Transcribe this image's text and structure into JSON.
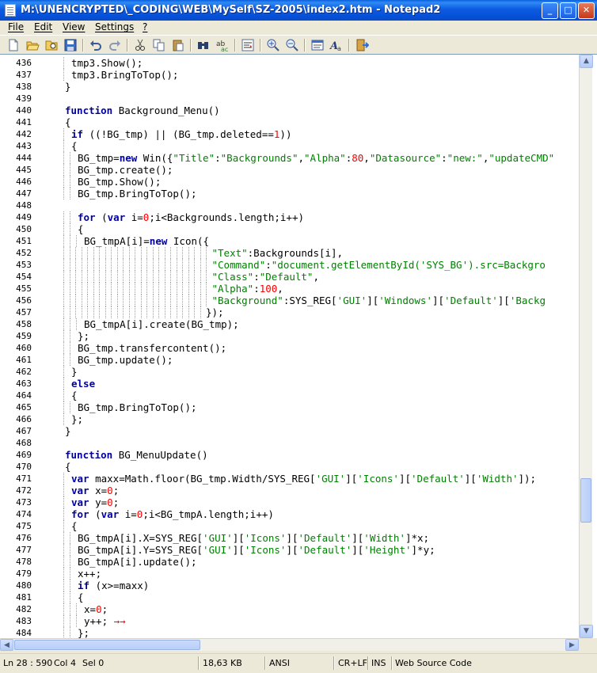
{
  "window": {
    "title": "M:\\UNENCRYPTED\\_CODING\\WEB\\MySelf\\SZ-2005\\index2.htm - Notepad2",
    "controls": {
      "minimize": "_",
      "maximize": "□",
      "close": "✕"
    }
  },
  "menu": [
    "File",
    "Edit",
    "View",
    "Settings",
    "?"
  ],
  "toolbar": {
    "icons": [
      "new-file-icon",
      "open-file-icon",
      "browse-icon",
      "save-icon",
      "undo-icon",
      "redo-icon",
      "cut-icon",
      "copy-icon",
      "paste-icon",
      "find-icon",
      "replace-icon",
      "word-wrap-icon",
      "zoom-in-icon",
      "zoom-out-icon",
      "scheme-icon",
      "font-icon",
      "exit-icon"
    ]
  },
  "colors": {
    "keyword": "#0000A0",
    "string": "#008000",
    "number": "#FF0000",
    "text": "#000000"
  },
  "editor": {
    "lines": [
      {
        "n": "436",
        "t": [
          [
            "p",
            "tmp3.Show();"
          ]
        ],
        "ind": 1
      },
      {
        "n": "437",
        "t": [
          [
            "p",
            "tmp3.BringToTop();"
          ]
        ],
        "ind": 1
      },
      {
        "n": "438",
        "t": [
          [
            "p",
            "}"
          ]
        ],
        "ind": 0
      },
      {
        "n": "439",
        "t": [],
        "ind": 0
      },
      {
        "n": "440",
        "t": [
          [
            "k",
            "function"
          ],
          [
            "p",
            " Background_Menu()"
          ]
        ],
        "ind": 0
      },
      {
        "n": "441",
        "t": [
          [
            "p",
            "{"
          ]
        ],
        "ind": 0
      },
      {
        "n": "442",
        "t": [
          [
            "k",
            "if"
          ],
          [
            "p",
            " ((!BG_tmp) || (BG_tmp.deleted=="
          ],
          [
            "n",
            "1"
          ],
          [
            "p",
            "))"
          ]
        ],
        "ind": 1
      },
      {
        "n": "443",
        "t": [
          [
            "p",
            "{"
          ]
        ],
        "ind": 1
      },
      {
        "n": "444",
        "t": [
          [
            "p",
            "BG_tmp="
          ],
          [
            "k",
            "new"
          ],
          [
            "p",
            " Win({"
          ],
          [
            "s",
            "\"Title\""
          ],
          [
            "p",
            ":"
          ],
          [
            "s",
            "\"Backgrounds\""
          ],
          [
            "p",
            ","
          ],
          [
            "s",
            "\"Alpha\""
          ],
          [
            "p",
            ":"
          ],
          [
            "n",
            "80"
          ],
          [
            "p",
            ","
          ],
          [
            "s",
            "\"Datasource\""
          ],
          [
            "p",
            ":"
          ],
          [
            "s",
            "\"new:\""
          ],
          [
            "p",
            ","
          ],
          [
            "s",
            "\"updateCMD\""
          ]
        ],
        "ind": 2
      },
      {
        "n": "445",
        "t": [
          [
            "p",
            "BG_tmp.create();"
          ]
        ],
        "ind": 2
      },
      {
        "n": "446",
        "t": [
          [
            "p",
            "BG_tmp.Show();"
          ]
        ],
        "ind": 2
      },
      {
        "n": "447",
        "t": [
          [
            "p",
            "BG_tmp.BringToTop();"
          ]
        ],
        "ind": 2
      },
      {
        "n": "448",
        "t": [],
        "ind": 0
      },
      {
        "n": "449",
        "t": [
          [
            "k",
            "for"
          ],
          [
            "p",
            " ("
          ],
          [
            "k",
            "var"
          ],
          [
            "p",
            " i="
          ],
          [
            "n",
            "0"
          ],
          [
            "p",
            ";i<Backgrounds.length;i++)"
          ]
        ],
        "ind": 2
      },
      {
        "n": "450",
        "t": [
          [
            "p",
            "{"
          ]
        ],
        "ind": 2
      },
      {
        "n": "451",
        "t": [
          [
            "p",
            "BG_tmpA[i]="
          ],
          [
            "k",
            "new"
          ],
          [
            "p",
            " Icon({"
          ]
        ],
        "ind": 3
      },
      {
        "n": "452",
        "t": [
          [
            "s",
            "\"Text\""
          ],
          [
            "p",
            ":Backgrounds[i],"
          ]
        ],
        "ind": 25
      },
      {
        "n": "453",
        "t": [
          [
            "s",
            "\"Command\""
          ],
          [
            "p",
            ":"
          ],
          [
            "s",
            "\"document.getElementById('SYS_BG').src=Backgro"
          ]
        ],
        "ind": 25
      },
      {
        "n": "454",
        "t": [
          [
            "s",
            "\"Class\""
          ],
          [
            "p",
            ":"
          ],
          [
            "s",
            "\"Default\""
          ],
          [
            "p",
            ","
          ]
        ],
        "ind": 25
      },
      {
        "n": "455",
        "t": [
          [
            "s",
            "\"Alpha\""
          ],
          [
            "p",
            ":"
          ],
          [
            "n",
            "100"
          ],
          [
            "p",
            ","
          ]
        ],
        "ind": 25
      },
      {
        "n": "456",
        "t": [
          [
            "s",
            "\"Background\""
          ],
          [
            "p",
            ":SYS_REG["
          ],
          [
            "s",
            "'GUI'"
          ],
          [
            "p",
            "]["
          ],
          [
            "s",
            "'Windows'"
          ],
          [
            "p",
            "]["
          ],
          [
            "s",
            "'Default'"
          ],
          [
            "p",
            "]["
          ],
          [
            "s",
            "'Backg"
          ]
        ],
        "ind": 25
      },
      {
        "n": "457",
        "t": [
          [
            "p",
            "});"
          ]
        ],
        "ind": 24
      },
      {
        "n": "458",
        "t": [
          [
            "p",
            "BG_tmpA[i].create(BG_tmp);"
          ]
        ],
        "ind": 3
      },
      {
        "n": "459",
        "t": [
          [
            "p",
            "};"
          ]
        ],
        "ind": 2
      },
      {
        "n": "460",
        "t": [
          [
            "p",
            "BG_tmp.transfercontent();"
          ]
        ],
        "ind": 2
      },
      {
        "n": "461",
        "t": [
          [
            "p",
            "BG_tmp.update();"
          ]
        ],
        "ind": 2
      },
      {
        "n": "462",
        "t": [
          [
            "p",
            "}"
          ]
        ],
        "ind": 1
      },
      {
        "n": "463",
        "t": [
          [
            "k",
            "else"
          ]
        ],
        "ind": 1
      },
      {
        "n": "464",
        "t": [
          [
            "p",
            "{"
          ]
        ],
        "ind": 1
      },
      {
        "n": "465",
        "t": [
          [
            "p",
            "BG_tmp.BringToTop();"
          ]
        ],
        "ind": 2
      },
      {
        "n": "466",
        "t": [
          [
            "p",
            "};"
          ]
        ],
        "ind": 1
      },
      {
        "n": "467",
        "t": [
          [
            "p",
            "}"
          ]
        ],
        "ind": 0
      },
      {
        "n": "468",
        "t": [],
        "ind": 0
      },
      {
        "n": "469",
        "t": [
          [
            "k",
            "function"
          ],
          [
            "p",
            " BG_MenuUpdate()"
          ]
        ],
        "ind": 0
      },
      {
        "n": "470",
        "t": [
          [
            "p",
            "{"
          ]
        ],
        "ind": 0
      },
      {
        "n": "471",
        "t": [
          [
            "k",
            "var"
          ],
          [
            "p",
            " maxx=Math.floor(BG_tmp.Width/SYS_REG["
          ],
          [
            "s",
            "'GUI'"
          ],
          [
            "p",
            "]["
          ],
          [
            "s",
            "'Icons'"
          ],
          [
            "p",
            "]["
          ],
          [
            "s",
            "'Default'"
          ],
          [
            "p",
            "]["
          ],
          [
            "s",
            "'Width'"
          ],
          [
            "p",
            "]);"
          ]
        ],
        "ind": 1
      },
      {
        "n": "472",
        "t": [
          [
            "k",
            "var"
          ],
          [
            "p",
            " x="
          ],
          [
            "n",
            "0"
          ],
          [
            "p",
            ";"
          ]
        ],
        "ind": 1
      },
      {
        "n": "473",
        "t": [
          [
            "k",
            "var"
          ],
          [
            "p",
            " y="
          ],
          [
            "n",
            "0"
          ],
          [
            "p",
            ";"
          ]
        ],
        "ind": 1
      },
      {
        "n": "474",
        "t": [
          [
            "k",
            "for"
          ],
          [
            "p",
            " ("
          ],
          [
            "k",
            "var"
          ],
          [
            "p",
            " i="
          ],
          [
            "n",
            "0"
          ],
          [
            "p",
            ";i<BG_tmpA.length;i++)"
          ]
        ],
        "ind": 1
      },
      {
        "n": "475",
        "t": [
          [
            "p",
            "{"
          ]
        ],
        "ind": 1
      },
      {
        "n": "476",
        "t": [
          [
            "p",
            "BG_tmpA[i].X=SYS_REG["
          ],
          [
            "s",
            "'GUI'"
          ],
          [
            "p",
            "]["
          ],
          [
            "s",
            "'Icons'"
          ],
          [
            "p",
            "]["
          ],
          [
            "s",
            "'Default'"
          ],
          [
            "p",
            "]["
          ],
          [
            "s",
            "'Width'"
          ],
          [
            "p",
            "]*x;"
          ]
        ],
        "ind": 2
      },
      {
        "n": "477",
        "t": [
          [
            "p",
            "BG_tmpA[i].Y=SYS_REG["
          ],
          [
            "s",
            "'GUI'"
          ],
          [
            "p",
            "]["
          ],
          [
            "s",
            "'Icons'"
          ],
          [
            "p",
            "]["
          ],
          [
            "s",
            "'Default'"
          ],
          [
            "p",
            "]["
          ],
          [
            "s",
            "'Height'"
          ],
          [
            "p",
            "]*y;"
          ]
        ],
        "ind": 2
      },
      {
        "n": "478",
        "t": [
          [
            "p",
            "BG_tmpA[i].update();"
          ]
        ],
        "ind": 2
      },
      {
        "n": "479",
        "t": [
          [
            "p",
            "x++;"
          ]
        ],
        "ind": 2
      },
      {
        "n": "480",
        "t": [
          [
            "k",
            "if"
          ],
          [
            "p",
            " (x>=maxx)"
          ]
        ],
        "ind": 2
      },
      {
        "n": "481",
        "t": [
          [
            "p",
            "{"
          ]
        ],
        "ind": 2
      },
      {
        "n": "482",
        "t": [
          [
            "p",
            "x="
          ],
          [
            "n",
            "0"
          ],
          [
            "p",
            ";"
          ]
        ],
        "ind": 3
      },
      {
        "n": "483",
        "t": [
          [
            "p",
            "y++;"
          ],
          [
            "n",
            " →→"
          ]
        ],
        "ind": 3
      },
      {
        "n": "484",
        "t": [
          [
            "p",
            "};"
          ]
        ],
        "ind": 2
      }
    ]
  },
  "status": {
    "position": "Ln 28 : 590",
    "col": "Col 4",
    "sel": "Sel 0",
    "size": "18,63 KB",
    "encoding": "ANSI",
    "eol": "CR+LF",
    "ovr": "INS",
    "scheme": "Web Source Code"
  }
}
